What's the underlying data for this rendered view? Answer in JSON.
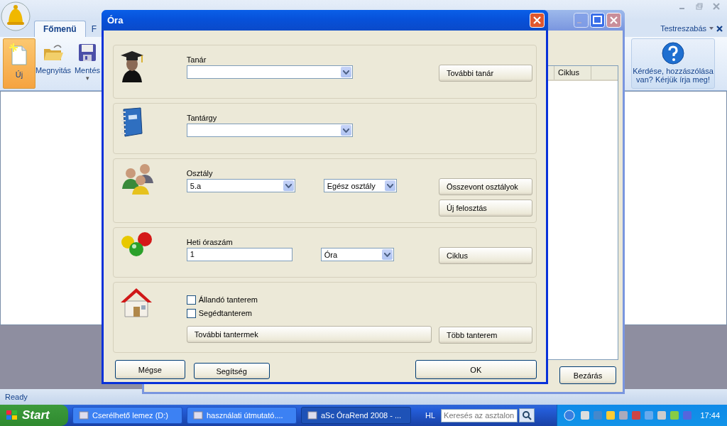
{
  "app": {
    "menu_tabs": [
      {
        "label": "Főmenü",
        "selected": true
      },
      {
        "label": "F",
        "selected": false
      }
    ],
    "toolbar": [
      {
        "label": "Új",
        "selected": true
      },
      {
        "label": "Megnyitás",
        "selected": false
      },
      {
        "label": "Mentés",
        "selected": false,
        "caret": "▾"
      }
    ],
    "customize": "Testreszabás",
    "help": "Kérdése, hozzászólása van? Kérjük írja meg!",
    "status": "Ready"
  },
  "back_window": {
    "columns": [
      "Ciklus"
    ],
    "close_button": "Bezárás"
  },
  "dialog": {
    "title": "Óra",
    "sections": [
      {
        "label": "Tanár",
        "fields": [
          {
            "kind": "combo"
          }
        ],
        "buttons": [
          "További tanár"
        ]
      },
      {
        "label": "Tantárgy",
        "fields": [
          {
            "kind": "combo"
          }
        ]
      },
      {
        "label": "Osztály",
        "fields": [
          {
            "kind": "combo",
            "value": "5.a"
          },
          {
            "kind": "combo",
            "value": "Egész osztály"
          }
        ],
        "buttons": [
          "Összevont osztályok",
          "Új felosztás"
        ]
      },
      {
        "label": "Heti óraszám",
        "fields": [
          {
            "kind": "text",
            "value": "1"
          },
          {
            "kind": "combo",
            "value": "Óra"
          }
        ],
        "buttons": [
          "Ciklus"
        ]
      },
      {
        "checkboxes": [
          {
            "label": "Állandó tanterem",
            "checked": false
          },
          {
            "label": "Segédtanterem",
            "checked": false
          }
        ],
        "wide_button": "További tantermek",
        "buttons": [
          "Több tanterem"
        ]
      }
    ],
    "footer": {
      "cancel": "Mégse",
      "help": "Segítség",
      "ok": "OK"
    }
  },
  "taskbar": {
    "start": "Start",
    "tasks": [
      {
        "label": "Cserélhető lemez (D:)",
        "selected": false
      },
      {
        "label": "használati útmutató....",
        "selected": false
      },
      {
        "label": "aSc ÓraRend 2008 - ...",
        "selected": true
      }
    ],
    "language": "HL",
    "search_placeholder": "Keresés az asztalon",
    "clock": "17:44"
  }
}
